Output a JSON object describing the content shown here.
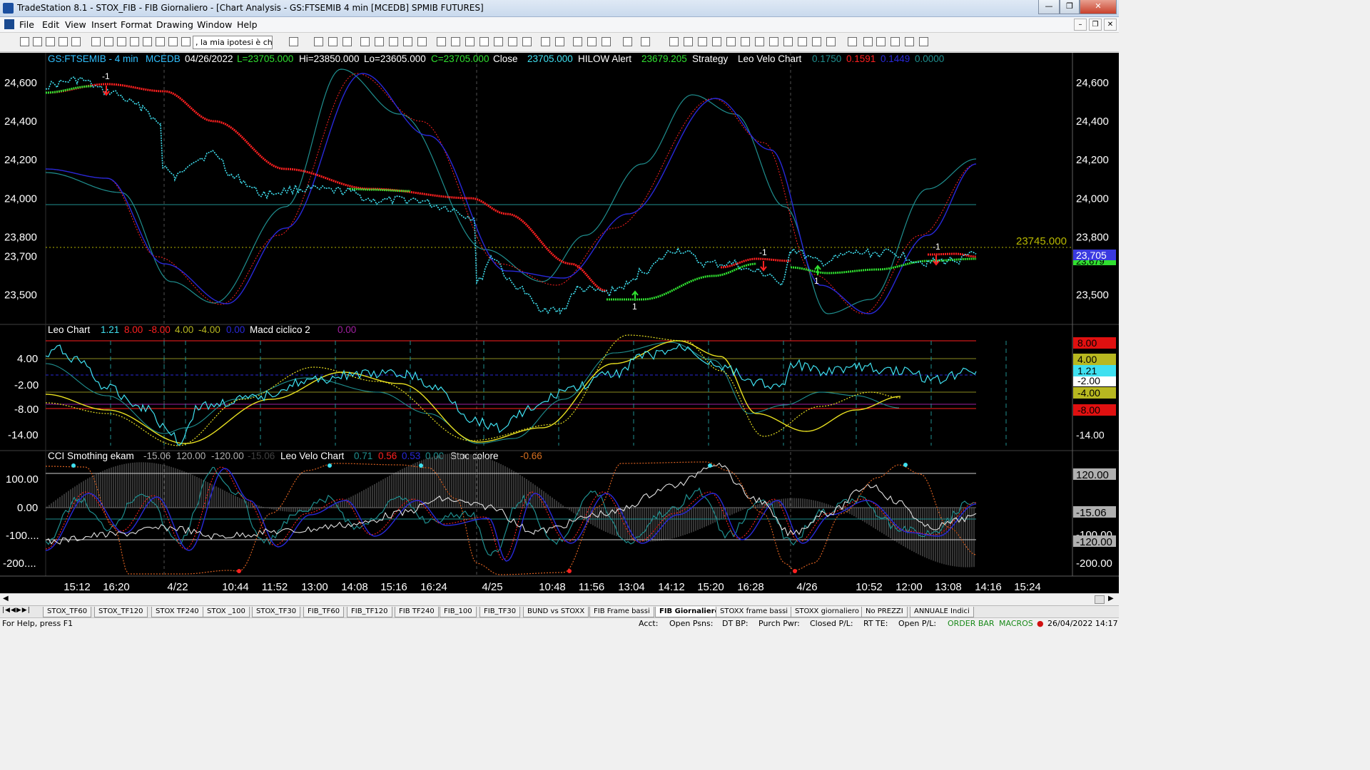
{
  "window": {
    "title": "TradeStation 8.1 - STOX_FIB - FIB Giornaliero - [Chart Analysis - GS:FTSEMIB  4 min  [MCEDB] SPMIB FUTURES]",
    "min_label": "—",
    "max_label": "❐",
    "close_label": "✕"
  },
  "menu": {
    "items": [
      "File",
      "Edit",
      "View",
      "Insert",
      "Format",
      "Drawing",
      "Window",
      "Help"
    ],
    "mdi_min": "–",
    "mdi_restore": "❐",
    "mdi_close": "✕"
  },
  "toolbar": {
    "combo_value": ", la mia ipotesi è ch"
  },
  "chart": {
    "header": {
      "symbol": "GS:FTSEMIB - 4 min",
      "feed": "MCEDB",
      "date": "04/26/2022",
      "last": "L=23705.000",
      "high": "Hi=23850.000",
      "low": "Lo=23605.000",
      "close": "C=23705.000",
      "close_label": "Close",
      "close_value": "23705.000",
      "hilow_label": "HILOW Alert",
      "hilow_value": "23679.205",
      "strategy_label": "Strategy",
      "velo_label": "Leo Velo Chart",
      "velo_v1": "0.1750",
      "velo_v2": "0.1591",
      "velo_v3": "0.1449",
      "velo_v4": "0.0000"
    },
    "colors": {
      "cyan": "#3fe0f0",
      "red": "#ff2020",
      "green": "#30e030",
      "blue": "#2828d8",
      "teal": "#1f8f8f",
      "yellow": "#e8e020",
      "dkred": "#c03030"
    },
    "price_axis": [
      "24,600",
      "24,400",
      "24,200",
      "24,000",
      "23,800",
      "23,700",
      "23,500"
    ],
    "price_axis_values": [
      24600,
      24400,
      24200,
      24000,
      23800,
      23700,
      23500
    ],
    "price_labels": {
      "left_alert": "23745.000",
      "right_close": "23,705",
      "right_hidden": "23,679"
    },
    "markers": {
      "m1": "-1",
      "m2": "1",
      "m3": "-1",
      "m4": "1",
      "m5": "-1"
    },
    "osc_header": {
      "label": "Leo Chart",
      "v1": "1.21",
      "v2": "8.00",
      "v3": "-8.00",
      "v4": "4.00",
      "v5": "-4.00",
      "v6": "0.00",
      "macd_label": "Macd ciclico 2",
      "macd_value": "0.00"
    },
    "osc_axis_left": [
      "4.00",
      "-2.00",
      "-8.00",
      "-14.00"
    ],
    "osc_axis_right": [
      "8.00",
      "4.00",
      "1.21",
      "-2.00",
      "-4.00",
      "-8.00",
      "-14.00"
    ],
    "cci_header": {
      "label": "CCI Smothing ekam",
      "v1": "-15.06",
      "v2": "120.00",
      "v3": "-120.00",
      "v4": "-15.06",
      "velo_label": "Leo Velo Chart",
      "velo_v1": "0.71",
      "velo_v2": "0.56",
      "velo_v3": "0.53",
      "velo_v4": "0.00",
      "stoc_label": "Stoc colore",
      "stoc_value": "-0.66"
    },
    "cci_axis_left": [
      "100.00",
      "0.00",
      "-100....",
      "-200...."
    ],
    "cci_axis_right": [
      "120.00",
      "-15.06",
      "-100.00",
      "-120.00",
      "-200.00"
    ],
    "time_axis": [
      "15:12",
      "16:20",
      "4/22",
      "10:44",
      "11:52",
      "13:00",
      "14:08",
      "15:16",
      "16:24",
      "4/25",
      "10:48",
      "11:56",
      "13:04",
      "14:12",
      "15:20",
      "16:28",
      "4/26",
      "10:52",
      "12:00",
      "13:08",
      "14:16",
      "15:24"
    ]
  },
  "tabs": [
    "STOX_TF60",
    "STOX_TF120",
    "STOX TF240",
    "STOX _100",
    "STOX_TF30",
    "FIB_TF60",
    "FIB_TF120",
    "FIB TF240",
    "FIB_100",
    "FIB_TF30",
    "BUND vs STOXX",
    "FIB Frame bassi",
    "FIB Giornaliero",
    "STOXX frame bassi",
    "STOXX giornaliero",
    "No PREZZI",
    "ANNUALE Indici"
  ],
  "status": {
    "help": "For Help, press F1",
    "acct": "Acct:",
    "open_psns": "Open Psns:",
    "dt_bp": "DT BP:",
    "purch_pwr": "Purch Pwr:",
    "closed_pl": "Closed P/L:",
    "rt_te": "RT TE:",
    "open_pl": "Open P/L:",
    "order_bar": "ORDER BAR",
    "macros": "MACROS",
    "datetime": "26/04/2022 14:17"
  }
}
